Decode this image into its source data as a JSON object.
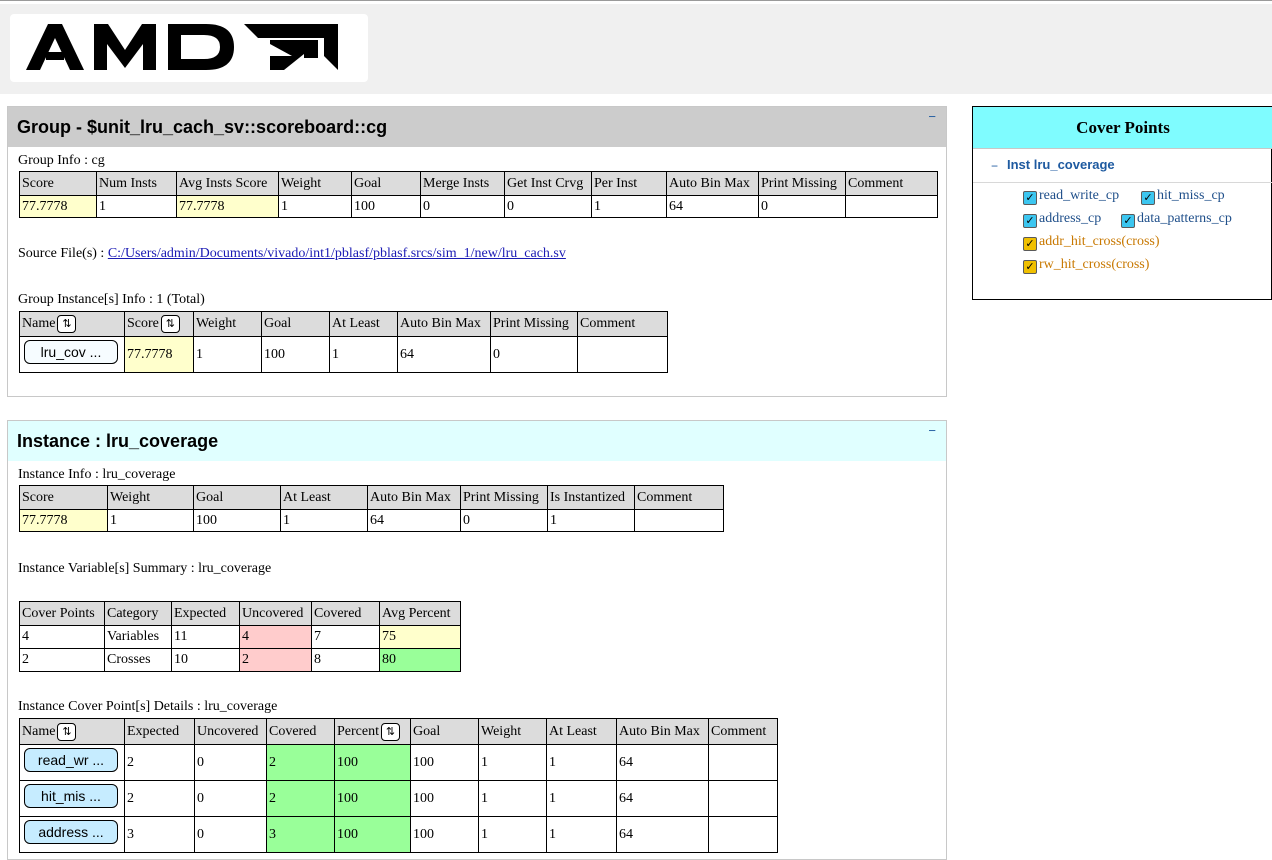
{
  "logo": {
    "text": "AMD"
  },
  "group": {
    "title": "Group - $unit_lru_cach_sv::scoreboard::cg",
    "collapse": "−",
    "info_label": "Group Info : cg",
    "info_headers": [
      "Score",
      "Num Insts",
      "Avg Insts Score",
      "Weight",
      "Goal",
      "Merge Insts",
      "Get Inst Crvg",
      "Per Inst",
      "Auto Bin Max",
      "Print Missing",
      "Comment"
    ],
    "info_values": [
      "77.7778",
      "1",
      "77.7778",
      "1",
      "100",
      "0",
      "0",
      "1",
      "64",
      "0",
      ""
    ],
    "source_label": "Source File(s) :",
    "source_path": "C:/Users/admin/Documents/vivado/int1/pblasf/pblasf.srcs/sim_1/new/lru_cach.sv",
    "instances_label": "Group Instance[s] Info : 1 (Total)",
    "inst_headers": [
      "Name",
      "Score",
      "Weight",
      "Goal",
      "At Least",
      "Auto Bin Max",
      "Print Missing",
      "Comment"
    ],
    "inst_row": {
      "name": "lru_cov ...",
      "score": "77.7778",
      "weight": "1",
      "goal": "100",
      "at_least": "1",
      "auto_bin_max": "64",
      "print_missing": "0",
      "comment": ""
    }
  },
  "instance": {
    "title": "Instance : lru_coverage",
    "collapse": "−",
    "info_label": "Instance Info : lru_coverage",
    "info_headers": [
      "Score",
      "Weight",
      "Goal",
      "At Least",
      "Auto Bin Max",
      "Print Missing",
      "Is Instantized",
      "Comment"
    ],
    "info_values": [
      "77.7778",
      "1",
      "100",
      "1",
      "64",
      "0",
      "1",
      ""
    ],
    "summary_label": "Instance Variable[s] Summary : lru_coverage",
    "summary_headers": [
      "Cover Points",
      "Category",
      "Expected",
      "Uncovered",
      "Covered",
      "Avg Percent"
    ],
    "summary_rows": [
      [
        "4",
        "Variables",
        "11",
        "4",
        "7",
        "75"
      ],
      [
        "2",
        "Crosses",
        "10",
        "2",
        "8",
        "80"
      ]
    ],
    "details_label": "Instance Cover Point[s] Details : lru_coverage",
    "details_headers": [
      "Name",
      "Expected",
      "Uncovered",
      "Covered",
      "Percent",
      "Goal",
      "Weight",
      "At Least",
      "Auto Bin Max",
      "Comment"
    ],
    "details_rows": [
      {
        "name": "read_wr ...",
        "expected": "2",
        "uncovered": "0",
        "covered": "2",
        "percent": "100",
        "goal": "100",
        "weight": "1",
        "at_least": "1",
        "auto_bin_max": "64",
        "comment": ""
      },
      {
        "name": "hit_mis ...",
        "expected": "2",
        "uncovered": "0",
        "covered": "2",
        "percent": "100",
        "goal": "100",
        "weight": "1",
        "at_least": "1",
        "auto_bin_max": "64",
        "comment": ""
      },
      {
        "name": "address ...",
        "expected": "3",
        "uncovered": "0",
        "covered": "3",
        "percent": "100",
        "goal": "100",
        "weight": "1",
        "at_least": "1",
        "auto_bin_max": "64",
        "comment": ""
      }
    ]
  },
  "cover_points": {
    "title": "Cover Points",
    "collapse": "−",
    "instance_label": "Inst lru_coverage",
    "items": [
      {
        "label": "read_write_cp",
        "checked": true
      },
      {
        "label": "hit_miss_cp",
        "checked": true
      },
      {
        "label": "address_cp",
        "checked": true
      },
      {
        "label": "data_patterns_cp",
        "checked": true
      },
      {
        "label": "addr_hit_cross(cross)",
        "checked": true
      },
      {
        "label": "rw_hit_cross(cross)",
        "checked": true
      }
    ]
  },
  "colors": {
    "yellow": "#ffffcc",
    "red": "#ffcccc",
    "green": "#99ff99",
    "cyan_header": "#7ffcff",
    "instance_header": "#e0ffff",
    "group_header": "#cccccc"
  },
  "icons": {
    "sort": "sort-arrows-icon",
    "check": "checkmark-icon"
  }
}
